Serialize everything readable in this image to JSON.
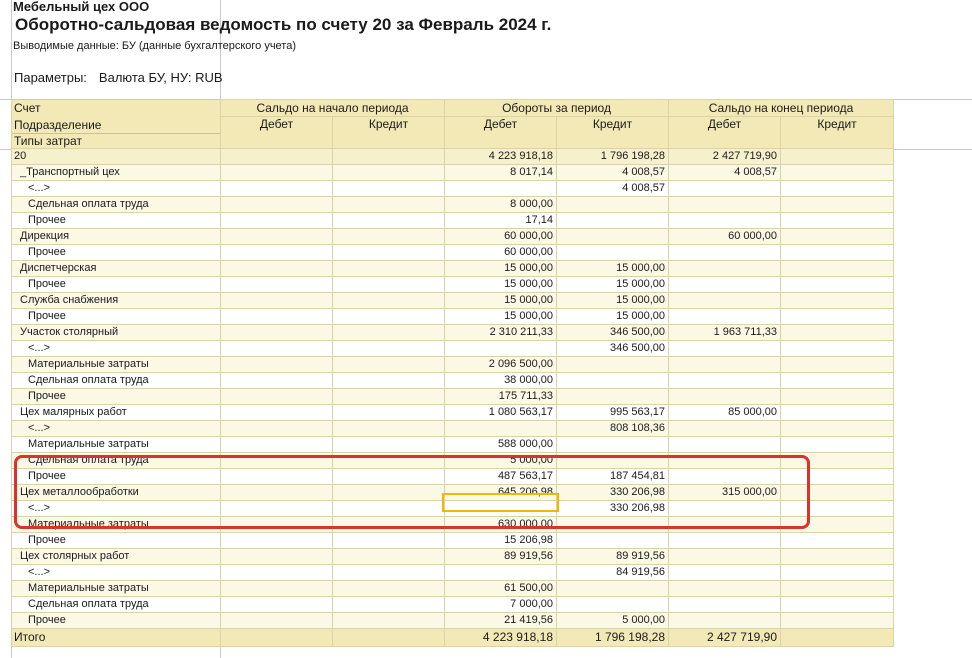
{
  "header": {
    "org": "Мебельный цех ООО",
    "title": "Оборотно-сальдовая ведомость по счету 20 за Февраль 2024 г.",
    "subtitle": "Выводимые данные: БУ (данные бухгалтерского учета)",
    "params_label": "Параметры:",
    "params_value": "Валюта БУ, НУ: RUB"
  },
  "columns": {
    "account": "Счет",
    "division": "Подразделение",
    "cost_types": "Типы затрат",
    "opening": "Сальдо на начало периода",
    "turnover": "Обороты за период",
    "closing": "Сальдо на конец периода",
    "debit": "Дебет",
    "credit": "Кредит"
  },
  "rows": [
    {
      "label": "20",
      "level": 0,
      "od": "",
      "oc": "",
      "td": "4 223 918,18",
      "tc": "1 796 198,28",
      "cd": "2 427 719,90",
      "cc": ""
    },
    {
      "label": "_Транспортный цех",
      "level": 1,
      "od": "",
      "oc": "",
      "td": "8 017,14",
      "tc": "4 008,57",
      "cd": "4 008,57",
      "cc": ""
    },
    {
      "label": "<...>",
      "level": 2,
      "od": "",
      "oc": "",
      "td": "",
      "tc": "4 008,57",
      "cd": "",
      "cc": ""
    },
    {
      "label": "Сдельная оплата труда",
      "level": 2,
      "od": "",
      "oc": "",
      "td": "8 000,00",
      "tc": "",
      "cd": "",
      "cc": ""
    },
    {
      "label": "Прочее",
      "level": 2,
      "od": "",
      "oc": "",
      "td": "17,14",
      "tc": "",
      "cd": "",
      "cc": ""
    },
    {
      "label": "Дирекция",
      "level": 1,
      "od": "",
      "oc": "",
      "td": "60 000,00",
      "tc": "",
      "cd": "60 000,00",
      "cc": ""
    },
    {
      "label": "Прочее",
      "level": 2,
      "od": "",
      "oc": "",
      "td": "60 000,00",
      "tc": "",
      "cd": "",
      "cc": ""
    },
    {
      "label": "Диспетчерская",
      "level": 1,
      "od": "",
      "oc": "",
      "td": "15 000,00",
      "tc": "15 000,00",
      "cd": "",
      "cc": ""
    },
    {
      "label": "Прочее",
      "level": 2,
      "od": "",
      "oc": "",
      "td": "15 000,00",
      "tc": "15 000,00",
      "cd": "",
      "cc": ""
    },
    {
      "label": "Служба снабжения",
      "level": 1,
      "od": "",
      "oc": "",
      "td": "15 000,00",
      "tc": "15 000,00",
      "cd": "",
      "cc": ""
    },
    {
      "label": "Прочее",
      "level": 2,
      "od": "",
      "oc": "",
      "td": "15 000,00",
      "tc": "15 000,00",
      "cd": "",
      "cc": ""
    },
    {
      "label": "Участок столярный",
      "level": 1,
      "od": "",
      "oc": "",
      "td": "2 310 211,33",
      "tc": "346 500,00",
      "cd": "1 963 711,33",
      "cc": ""
    },
    {
      "label": "<...>",
      "level": 2,
      "od": "",
      "oc": "",
      "td": "",
      "tc": "346 500,00",
      "cd": "",
      "cc": ""
    },
    {
      "label": "Материальные затраты",
      "level": 2,
      "od": "",
      "oc": "",
      "td": "2 096 500,00",
      "tc": "",
      "cd": "",
      "cc": ""
    },
    {
      "label": "Сдельная оплата труда",
      "level": 2,
      "od": "",
      "oc": "",
      "td": "38 000,00",
      "tc": "",
      "cd": "",
      "cc": ""
    },
    {
      "label": "Прочее",
      "level": 2,
      "od": "",
      "oc": "",
      "td": "175 711,33",
      "tc": "",
      "cd": "",
      "cc": ""
    },
    {
      "label": "Цех малярных работ",
      "level": 1,
      "od": "",
      "oc": "",
      "td": "1 080 563,17",
      "tc": "995 563,17",
      "cd": "85 000,00",
      "cc": ""
    },
    {
      "label": "<...>",
      "level": 2,
      "od": "",
      "oc": "",
      "td": "",
      "tc": "808 108,36",
      "cd": "",
      "cc": ""
    },
    {
      "label": "Материальные затраты",
      "level": 2,
      "od": "",
      "oc": "",
      "td": "588 000,00",
      "tc": "",
      "cd": "",
      "cc": ""
    },
    {
      "label": "Сдельная оплата труда",
      "level": 2,
      "od": "",
      "oc": "",
      "td": "5 000,00",
      "tc": "",
      "cd": "",
      "cc": ""
    },
    {
      "label": "Прочее",
      "level": 2,
      "od": "",
      "oc": "",
      "td": "487 563,17",
      "tc": "187 454,81",
      "cd": "",
      "cc": ""
    },
    {
      "label": "Цех металлообработки",
      "level": 1,
      "od": "",
      "oc": "",
      "td": "645 206,98",
      "tc": "330 206,98",
      "cd": "315 000,00",
      "cc": ""
    },
    {
      "label": "<...>",
      "level": 2,
      "od": "",
      "oc": "",
      "td": "",
      "tc": "330 206,98",
      "cd": "",
      "cc": ""
    },
    {
      "label": "Материальные затраты",
      "level": 2,
      "od": "",
      "oc": "",
      "td": "630 000,00",
      "tc": "",
      "cd": "",
      "cc": ""
    },
    {
      "label": "Прочее",
      "level": 2,
      "od": "",
      "oc": "",
      "td": "15 206,98",
      "tc": "",
      "cd": "",
      "cc": ""
    },
    {
      "label": "Цех столярных работ",
      "level": 1,
      "od": "",
      "oc": "",
      "td": "89 919,56",
      "tc": "89 919,56",
      "cd": "",
      "cc": ""
    },
    {
      "label": "<...>",
      "level": 2,
      "od": "",
      "oc": "",
      "td": "",
      "tc": "84 919,56",
      "cd": "",
      "cc": ""
    },
    {
      "label": "Материальные затраты",
      "level": 2,
      "od": "",
      "oc": "",
      "td": "61 500,00",
      "tc": "",
      "cd": "",
      "cc": ""
    },
    {
      "label": "Сдельная оплата труда",
      "level": 2,
      "od": "",
      "oc": "",
      "td": "7 000,00",
      "tc": "",
      "cd": "",
      "cc": ""
    },
    {
      "label": "Прочее",
      "level": 2,
      "od": "",
      "oc": "",
      "td": "21 419,56",
      "tc": "5 000,00",
      "cd": "",
      "cc": ""
    }
  ],
  "total": {
    "label": "Итого",
    "od": "",
    "oc": "",
    "td": "4 223 918,18",
    "tc": "1 796 198,28",
    "cd": "2 427 719,90",
    "cc": ""
  },
  "colors": {
    "header_bg": "#f3e9b6",
    "callout": "#d9342b",
    "cell_highlight": "#f2b705"
  }
}
